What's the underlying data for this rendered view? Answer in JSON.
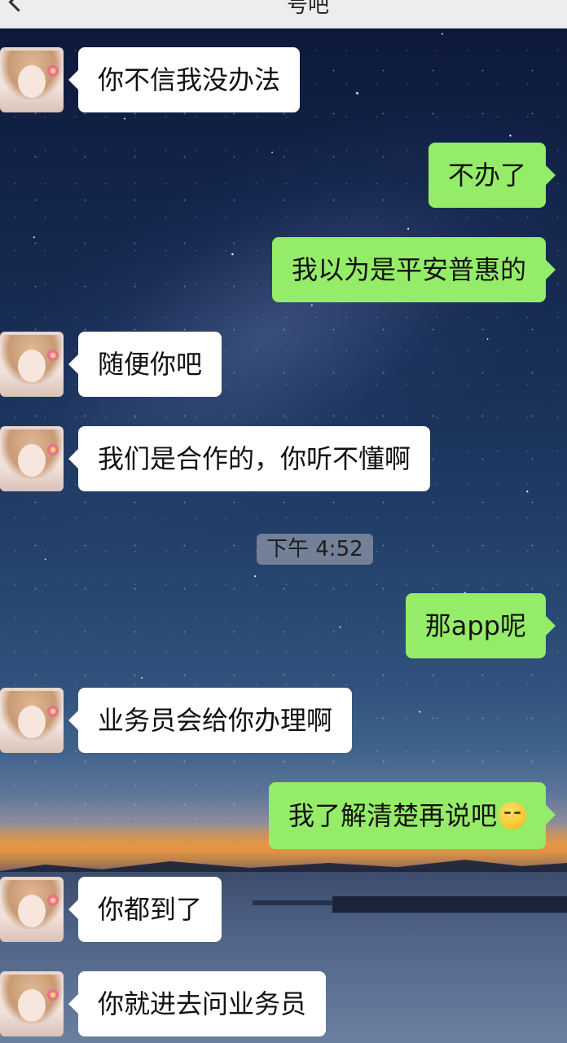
{
  "header": {
    "title_partial": "号吧"
  },
  "messages": [
    {
      "side": "in",
      "text": "你不信我没办法"
    },
    {
      "side": "out",
      "text": "不办了"
    },
    {
      "side": "out",
      "text": "我以为是平安普惠的"
    },
    {
      "side": "in",
      "text": "随便你吧"
    },
    {
      "side": "in",
      "text": "我们是合作的，你听不懂啊"
    },
    {
      "side": "out",
      "text": "那app呢"
    },
    {
      "side": "in",
      "text": "业务员会给你办理啊"
    },
    {
      "side": "out",
      "text": "我了解清楚再说吧",
      "emoji": "smirk-emoji-icon"
    },
    {
      "side": "in",
      "text": "你都到了"
    },
    {
      "side": "in",
      "text": "你就进去问业务员"
    }
  ],
  "timestamp": "下午 4:52",
  "colors": {
    "outgoing_bubble": "#95ec69",
    "incoming_bubble": "#ffffff",
    "header_bg": "#ededed"
  }
}
